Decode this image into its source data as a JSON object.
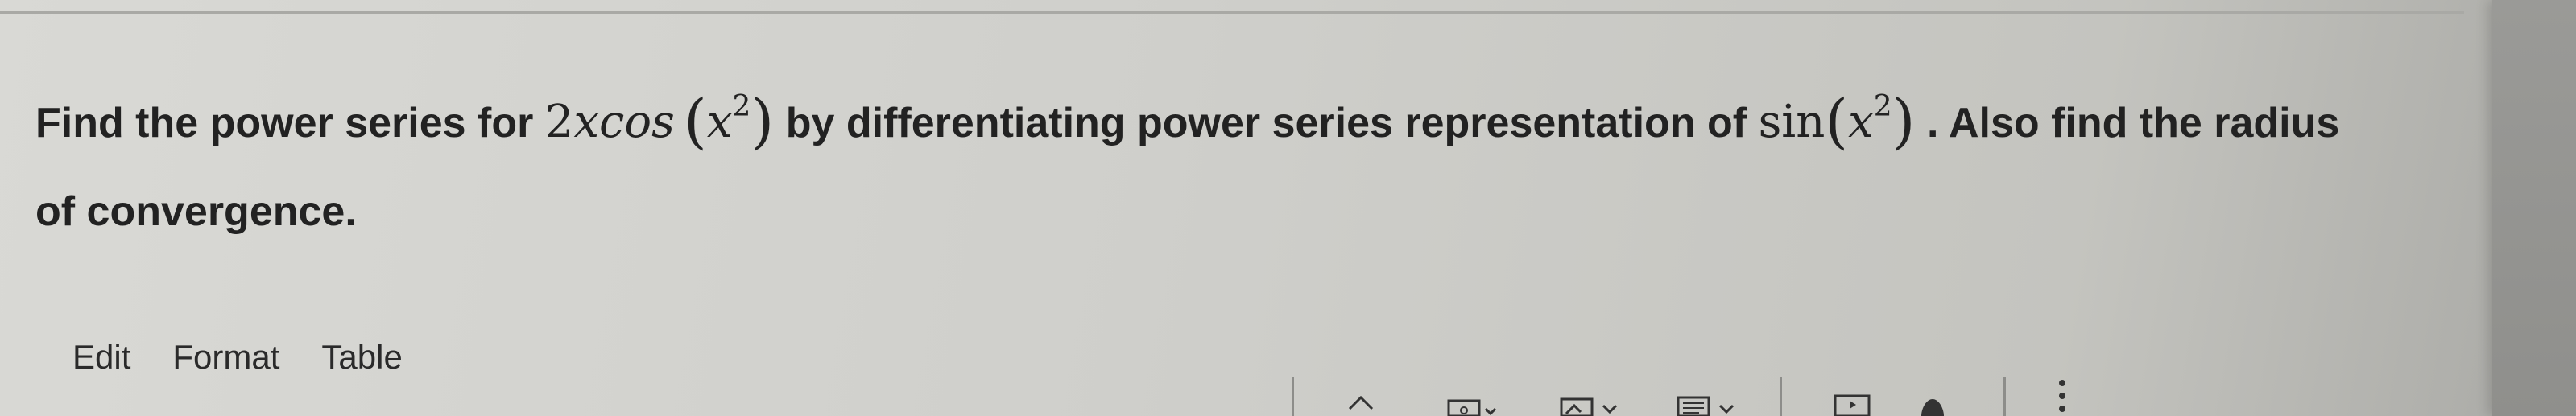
{
  "question": {
    "line1_a": "Find the power series for",
    "expr1": {
      "coef": "2",
      "var": "x",
      "fn": "cos",
      "open": "(",
      "base": "x",
      "exp": "2",
      "close": ")"
    },
    "line1_b": "by differentiating power series representation of",
    "expr2": {
      "fn": "sin",
      "open": "(",
      "base": "x",
      "exp": "2",
      "close": ")"
    },
    "line1_c": ". Also find the radius",
    "line2": "of convergence."
  },
  "menu": {
    "edit": "Edit",
    "format": "Format",
    "table": "Table"
  },
  "toolbar": {
    "icons": [
      "undo-icon",
      "link-icon",
      "image-icon",
      "text-block-icon",
      "media-icon",
      "accessibility-icon",
      "more-icon"
    ]
  }
}
